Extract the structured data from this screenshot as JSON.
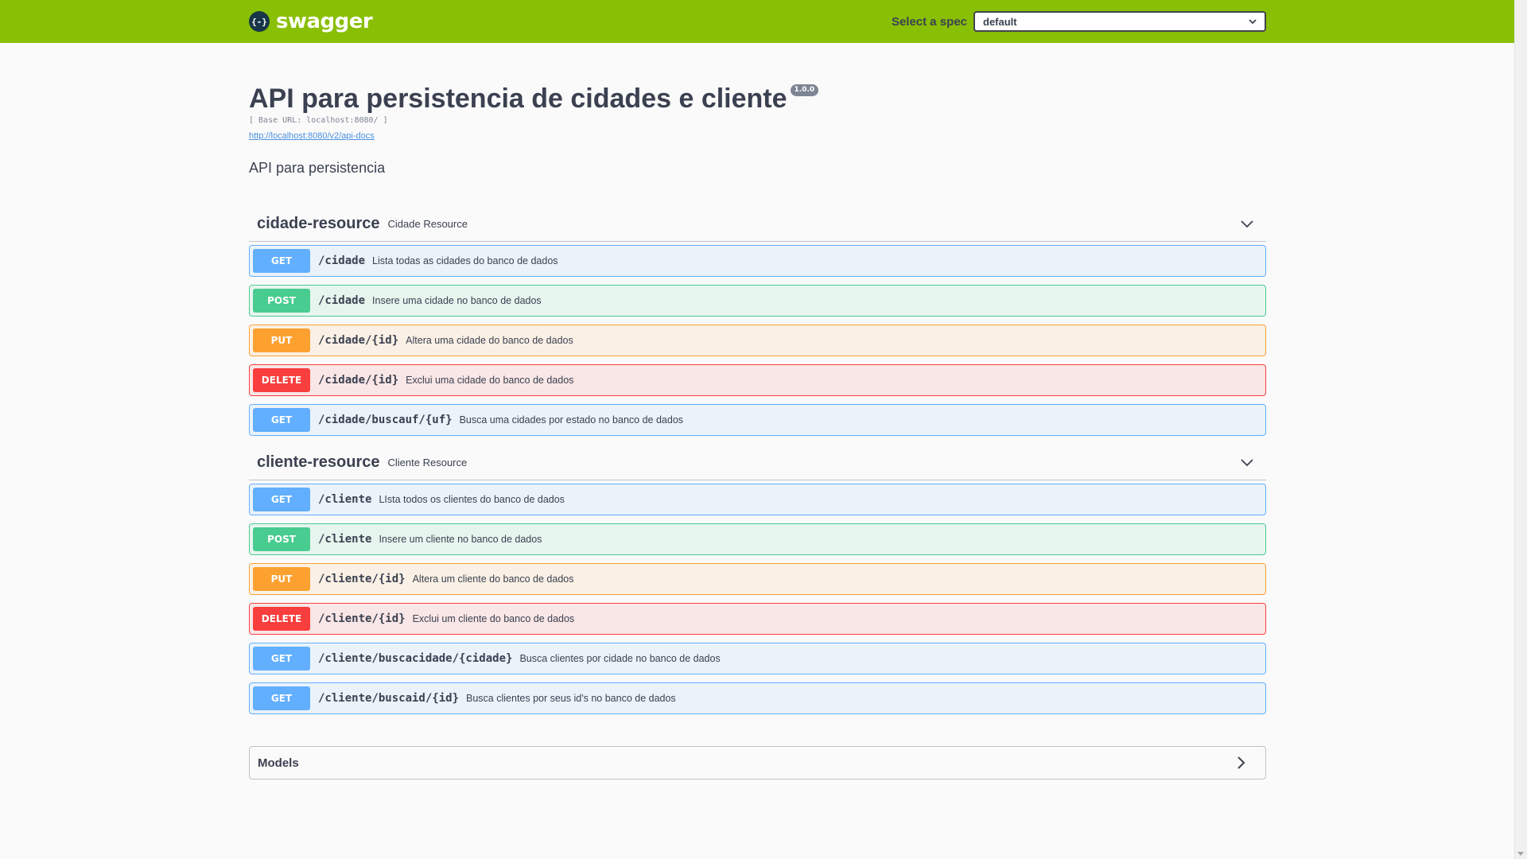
{
  "topbar": {
    "logo_text": "swagger",
    "logo_mark": "{-}",
    "spec_label": "Select a spec",
    "spec_value": "default"
  },
  "info": {
    "title": "API para persistencia de cidades e cliente",
    "version": "1.0.0",
    "base_url": "[ Base URL: localhost:8080/ ]",
    "docs_link": "http://localhost:8080/v2/api-docs",
    "description": "API para persistencia"
  },
  "tags": [
    {
      "name": "cidade-resource",
      "description": "Cidade Resource",
      "operations": [
        {
          "method": "GET",
          "path": "/cidade",
          "summary": "Lista todas as cidades do banco de dados"
        },
        {
          "method": "POST",
          "path": "/cidade",
          "summary": "Insere uma cidade no banco de dados"
        },
        {
          "method": "PUT",
          "path": "/cidade/{id}",
          "summary": "Altera uma cidade do banco de dados"
        },
        {
          "method": "DELETE",
          "path": "/cidade/{id}",
          "summary": "Exclui uma cidade do banco de dados"
        },
        {
          "method": "GET",
          "path": "/cidade/buscauf/{uf}",
          "summary": "Busca uma cidades por estado no banco de dados"
        }
      ]
    },
    {
      "name": "cliente-resource",
      "description": "Cliente Resource",
      "operations": [
        {
          "method": "GET",
          "path": "/cliente",
          "summary": "LIsta todos os clientes do banco de dados"
        },
        {
          "method": "POST",
          "path": "/cliente",
          "summary": "Insere um cliente no banco de dados"
        },
        {
          "method": "PUT",
          "path": "/cliente/{id}",
          "summary": "Altera um cliente do banco de dados"
        },
        {
          "method": "DELETE",
          "path": "/cliente/{id}",
          "summary": "Exclui um cliente do banco de dados"
        },
        {
          "method": "GET",
          "path": "/cliente/buscacidade/{cidade}",
          "summary": "Busca clientes por cidade no banco de dados"
        },
        {
          "method": "GET",
          "path": "/cliente/buscaid/{id}",
          "summary": "Busca clientes por seus id's no banco de dados"
        }
      ]
    }
  ],
  "models": {
    "title": "Models"
  },
  "icons": {
    "select": "chevron-down-icon",
    "tag_toggle": "chevron-down-icon",
    "models_toggle": "chevron-right-icon"
  },
  "colors": {
    "topbar": "#89bf04",
    "get": "#61affe",
    "post": "#49cc90",
    "put": "#fca130",
    "delete": "#f93e3e"
  }
}
